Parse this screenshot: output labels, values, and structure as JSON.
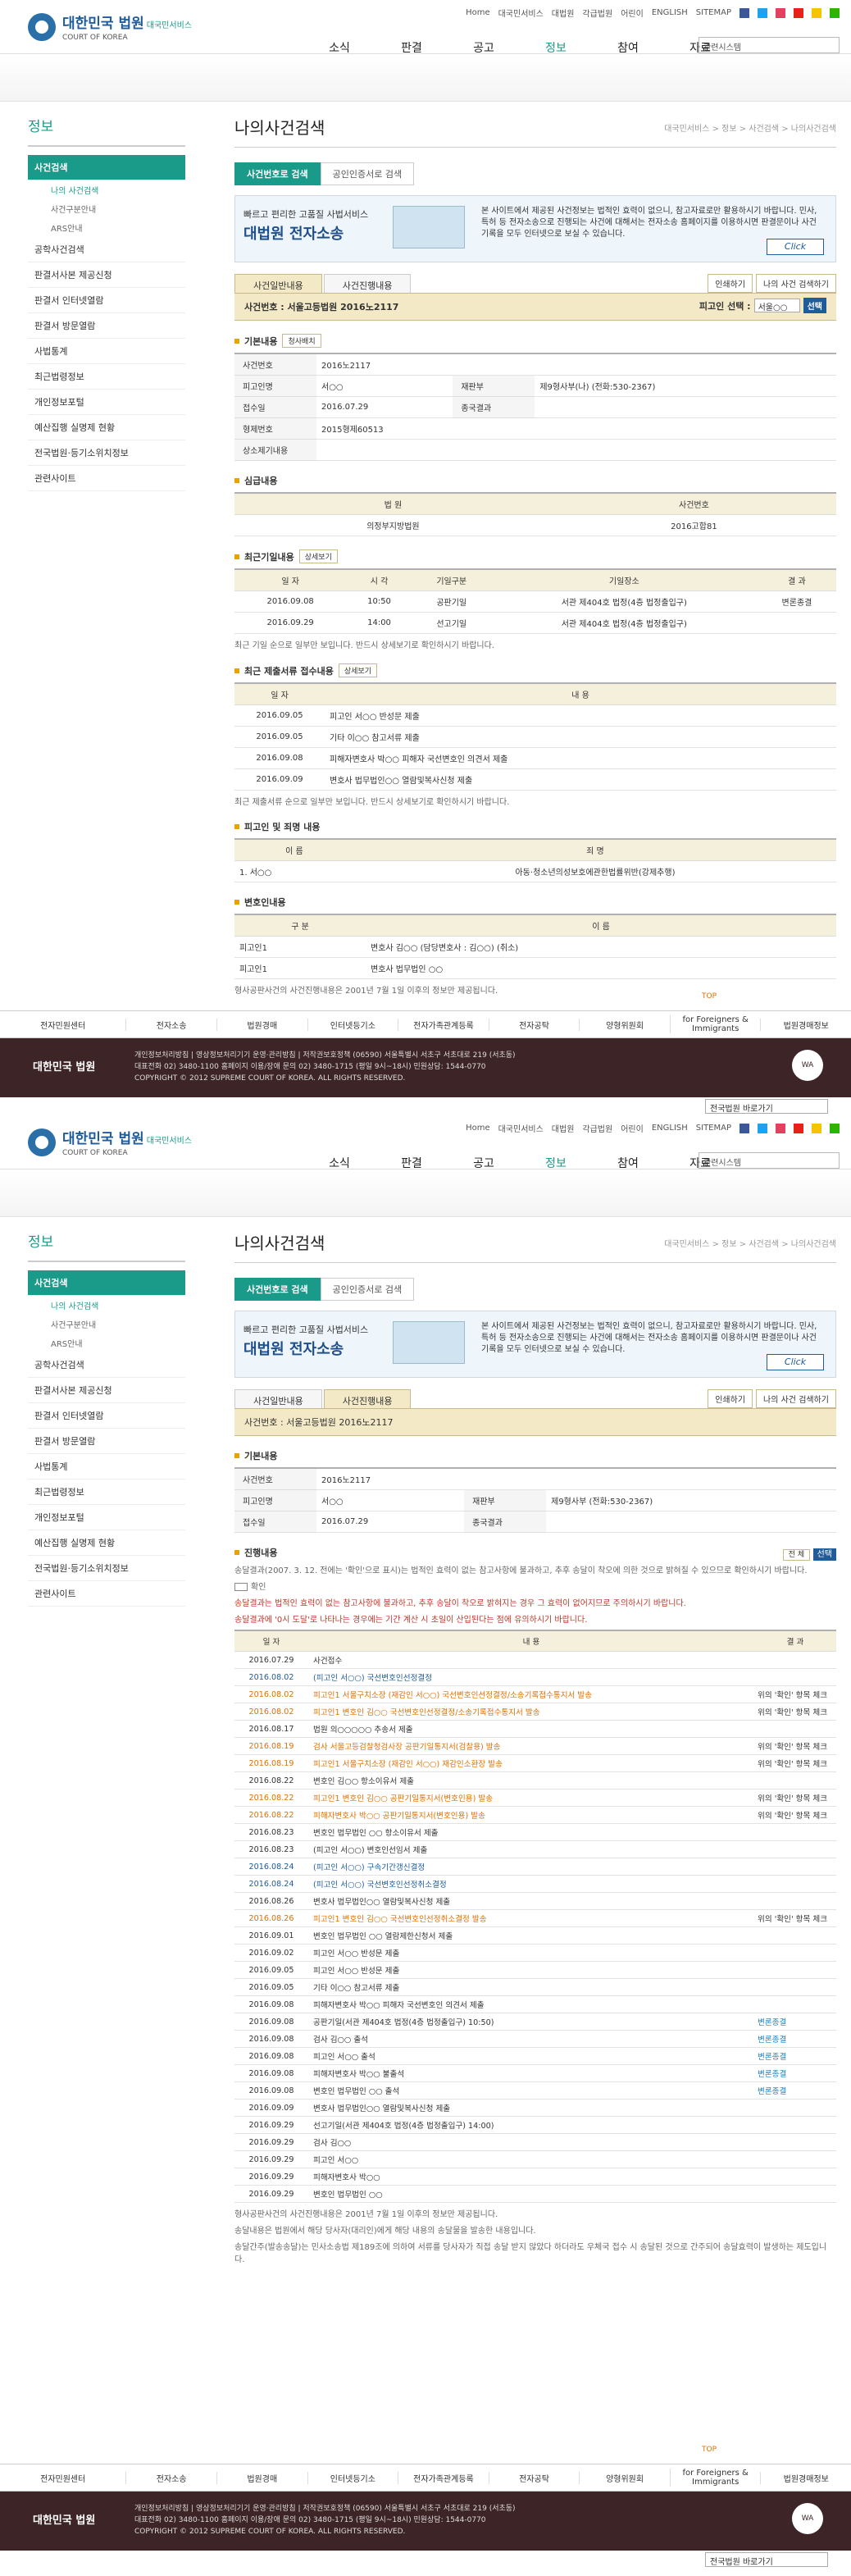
{
  "header": {
    "logo_title": "대한민국 법원",
    "logo_sub": "대국민서비스",
    "logo_en": "COURT OF KOREA",
    "util": [
      "Home",
      "대국민서비스",
      "대법원",
      "각급법원",
      "어린이",
      "ENGLISH",
      "SITEMAP"
    ],
    "gnb": [
      "소식",
      "판결",
      "공고",
      "정보",
      "참여",
      "자료"
    ],
    "search_select": "관련시스템"
  },
  "sidebar": {
    "title": "정보",
    "items": [
      "사건검색",
      "나의 사건검색",
      "사건구분안내",
      "ARS안내",
      "공학사건검색",
      "판결서사본 제공신청",
      "판결서 인터넷열람",
      "판결서 방문열람",
      "사법통계",
      "최근법령정보",
      "개인정보포털",
      "예산집행 실명제 현황",
      "전국법원·등기소위치정보",
      "관련사이트"
    ]
  },
  "page": {
    "title": "나의사건검색",
    "breadcrumb": "대국민서비스 > 정보 > 사건검색 > 나의사건검색",
    "tab1": "사건번호로 검색",
    "tab2": "공인인증서로 검색"
  },
  "ecase": {
    "a": "빠르고 편리한 고품질 사법서비스",
    "b": "대법원 전자소송",
    "d": "본 사이트에서 제공된 사건정보는 법적인 효력이 없으니, 참고자료로만 활용하시기 바랍니다. 민사, 특허 등 전자소송으로 진행되는 사건에 대해서는 전자소송 홈페이지를 이용하시면 판결문이나 사건기록을 모두 인터넷으로 보실 수 있습니다.",
    "btn": "Click"
  },
  "s1": {
    "stab1": "사건일반내용",
    "stab2": "사건진행내용",
    "print": "인쇄하기",
    "save": "나의 사건 검색하기",
    "casebar": "사건번호 : 서울고등법원 2016노2117",
    "party_sel_label": "피고인 선택 :",
    "party_sel": "서울○○",
    "go": "선택",
    "basic_title": "기본내용",
    "basic_btn": "청사배치",
    "basic": [
      [
        "사건번호",
        "2016노2117",
        "",
        ""
      ],
      [
        "피고인명",
        "서○○",
        "재판부",
        "제9형사부(나) (전화:530-2367)"
      ],
      [
        "접수일",
        "2016.07.29",
        "종국결과",
        ""
      ],
      [
        "형제번호",
        "2015형제60513",
        "",
        " "
      ],
      [
        "상소제기내용",
        "",
        "",
        ""
      ]
    ],
    "lower_title": "심급내용",
    "lower_head": [
      "법 원",
      "사건번호"
    ],
    "lower_row": [
      "의정부지방법원",
      "2016고합81"
    ],
    "hearing_title": "최근기일내용",
    "hearing_btn": "상세보기",
    "hearing_head": [
      "일 자",
      "시 각",
      "기일구분",
      "기일장소",
      "결 과"
    ],
    "hearing": [
      [
        "2016.09.08",
        "10:50",
        "공판기일",
        "서관 제404호 법정(4층 법정출입구)",
        "변론종결"
      ],
      [
        "2016.09.29",
        "14:00",
        "선고기일",
        "서관 제404호 법정(4층 법정출입구)",
        ""
      ]
    ],
    "hearing_note": "최근 기일 순으로 일부만 보입니다. 반드시 상세보기로 확인하시기 바랍니다.",
    "docs_title": "최근 제출서류 접수내용",
    "docs_btn": "상세보기",
    "docs_head": [
      "일 자",
      "내 용"
    ],
    "docs": [
      [
        "2016.09.05",
        "피고인 서○○ 반성문 제출"
      ],
      [
        "2016.09.05",
        "기타 이○○ 참고서류 제출"
      ],
      [
        "2016.09.08",
        "피해자변호사 박○○ 피해자 국선변호인 의견서 제출"
      ],
      [
        "2016.09.09",
        "변호사 법무법인○○ 열람및복사신청 제출"
      ]
    ],
    "docs_note": "최근 제출서류 순으로 일부만 보입니다. 반드시 상세보기로 확인하시기 바랍니다.",
    "charge_title": "피고인 및 죄명 내용",
    "charge_head": [
      "이 름",
      "죄 명"
    ],
    "charge_row": [
      "1. 서○○",
      "아동·청소년의성보호에관한법률위반(강제추행)"
    ],
    "lawyer_title": "변호인내용",
    "lawyer_head": [
      "구 분",
      "이 름"
    ],
    "lawyers": [
      [
        "피고인1",
        "변호사 김○○ (담당변호사 : 김○○) (취소)"
      ],
      [
        "피고인1",
        "변호사 법무법인 ○○"
      ]
    ],
    "footnote": "형사공판사건의 사건진행내용은 2001년 7월 1일 이후의 정보만 제공됩니다.",
    "top": "TOP"
  },
  "s2": {
    "casebar": "사건번호 : 서울고등법원 2016노2117",
    "basic": [
      [
        "사건번호",
        "2016노2117",
        "",
        ""
      ],
      [
        "피고인명",
        "서○○",
        "재판부",
        "제9형사부 (전화:530-2367)"
      ],
      [
        "접수일",
        "2016.07.29",
        "종국결과",
        ""
      ]
    ],
    "prog_title": "진행내용",
    "prog_sel": "전 체",
    "prog_go": "선택",
    "prog_notes": [
      "송달결과(2007. 3. 12. 전에는 '확인'으로 표시)는 법적인 효력이 없는 참고사항에 불과하고, 추후 송달이 착오에 의한 것으로 밝혀질 수 있으므로 확인하시기 바랍니다.",
      "확인",
      "송달결과는 법적인 효력이 없는 참고사항에 불과하고, 추후 송달이 착오로 밝혀지는 경우 그 효력이 없어지므로 주의하시기 바랍니다.",
      "송달결과에 '0시 도달'로 나타나는 경우에는 기간 계산 시 초일이 산입된다는 점에 유의하시기 바랍니다."
    ],
    "prog_head": [
      "일 자",
      "내 용",
      "결 과"
    ],
    "prog": [
      [
        "2016.07.29",
        "사건접수",
        "",
        ""
      ],
      [
        "2016.08.02",
        "(피고인 서○○) 국선변호인선정결정",
        "",
        "g"
      ],
      [
        "2016.08.02",
        "피고인1 서울구치소장 (재감인 서○○) 국선변호인선정결정/소송기록접수통지서 발송",
        "위의 '확인' 항목 체크",
        "o"
      ],
      [
        "2016.08.02",
        "피고인1 변호인 김○○ 국선변호인선정결정/소송기록접수통지서 발송",
        "위의 '확인' 항목 체크",
        "o"
      ],
      [
        "2016.08.17",
        "법원 의○○○○○ 추송서 제출",
        "",
        ""
      ],
      [
        "2016.08.19",
        "검사 서울고등검찰청검사장 공판기일통지서(검찰용) 발송",
        "위의 '확인' 항목 체크",
        "o"
      ],
      [
        "2016.08.19",
        "피고인1 서울구치소장 (재감인 서○○) 재감인소환장 발송",
        "위의 '확인' 항목 체크",
        "o"
      ],
      [
        "2016.08.22",
        "변호인 김○○ 항소이유서 제출",
        "",
        ""
      ],
      [
        "2016.08.22",
        "피고인1 변호인 김○○ 공판기일통지서(변호인용) 발송",
        "위의 '확인' 항목 체크",
        "o"
      ],
      [
        "2016.08.22",
        "피해자변호사 박○○ 공판기일통지서(변호인용) 발송",
        "위의 '확인' 항목 체크",
        "o"
      ],
      [
        "2016.08.23",
        "변호인 법무법인 ○○ 항소이유서 제출",
        "",
        ""
      ],
      [
        "2016.08.23",
        "(피고인 서○○) 변호인선임서 제출",
        "",
        ""
      ],
      [
        "2016.08.24",
        "(피고인 서○○) 구속기간갱신결정",
        "",
        "g"
      ],
      [
        "2016.08.24",
        "(피고인 서○○) 국선변호인선정취소결정",
        "",
        "g"
      ],
      [
        "2016.08.26",
        "변호사 법무법인○○ 열람및복사신청 제출",
        "",
        ""
      ],
      [
        "2016.08.26",
        "피고인1 변호인 김○○ 국선변호인선정취소결정 발송",
        "위의 '확인' 항목 체크",
        "o"
      ],
      [
        "2016.09.01",
        "변호인 법무법인 ○○ 열람제한신청서 제출",
        "",
        ""
      ],
      [
        "2016.09.02",
        "피고인 서○○ 반성문 제출",
        "",
        ""
      ],
      [
        "2016.09.05",
        "피고인 서○○ 반성문 제출",
        "",
        ""
      ],
      [
        "2016.09.05",
        "기타 이○○ 참고서류 제출",
        "",
        ""
      ],
      [
        "2016.09.08",
        "피해자변호사 박○○ 피해자 국선변호인 의견서 제출",
        "",
        ""
      ],
      [
        "2016.09.08",
        "공판기일(서관 제404호 법정(4층 법정출입구) 10:50)",
        "변론종결",
        "b"
      ],
      [
        "2016.09.08",
        "검사 김○○ 출석",
        "변론종결",
        "b"
      ],
      [
        "2016.09.08",
        "피고인 서○○ 출석",
        "변론종결",
        "b"
      ],
      [
        "2016.09.08",
        "피해자변호사 박○○ 불출석",
        "변론종결",
        "b"
      ],
      [
        "2016.09.08",
        "변호인 법무법인 ○○ 출석",
        "변론종결",
        "b"
      ],
      [
        "2016.09.09",
        "변호사 법무법인○○ 열람및복사신청 제출",
        "",
        ""
      ],
      [
        "2016.09.29",
        "선고기일(서관 제404호 법정(4층 법정출입구) 14:00)",
        "",
        "b"
      ],
      [
        "2016.09.29",
        "검사 김○○",
        "",
        ""
      ],
      [
        "2016.09.29",
        "피고인 서○○",
        "",
        ""
      ],
      [
        "2016.09.29",
        "피해자변호사 박○○",
        "",
        ""
      ],
      [
        "2016.09.29",
        "변호인 법무법인 ○○",
        "",
        ""
      ]
    ],
    "notes": [
      "형사공판사건의 사건진행내용은 2001년 7월 1일 이후의 정보만 제공됩니다.",
      "송달내용은 법원에서 해당 당사자(대리인)에게 해당 내용의 송달물을 발송한 내용입니다.",
      "송달간주(발송송달)는 민사소송법 제189조에 의하여 서류를 당사자가 직접 송달 받지 않았다 하더라도 우체국 접수 시 송달된 것으로 간주되어 송달효력이 발생하는 제도입니다."
    ]
  },
  "footer": {
    "nav": [
      "전자민원센터",
      "전자소송",
      "법원경매",
      "인터넷등기소",
      "전자가족관계등록",
      "전자공탁",
      "양형위원회",
      "for Foreigners & Immigrants",
      "법원경매정보"
    ],
    "logo": "대한민국 법원",
    "lines": [
      "개인정보처리방침 | 영상정보처리기기 운영·관리방침 | 저작권보호정책 (06590) 서울특별시 서초구 서초대로 219 (서초동)",
      "대표전화 02) 3480-1100 홈페이지 이용/장애 문의 02) 3480-1715 (평일 9시~18시) 민원상담: 1544-0770",
      "COPYRIGHT © 2012 SUPREME COURT OF KOREA. ALL RIGHTS RESERVED."
    ],
    "mark": "WA",
    "select": "전국법원 바로가기"
  },
  "colors": {
    "accent": "#1a9b8a",
    "footer_bg": "#3d2427",
    "case_bar": "#f3e9c7"
  }
}
